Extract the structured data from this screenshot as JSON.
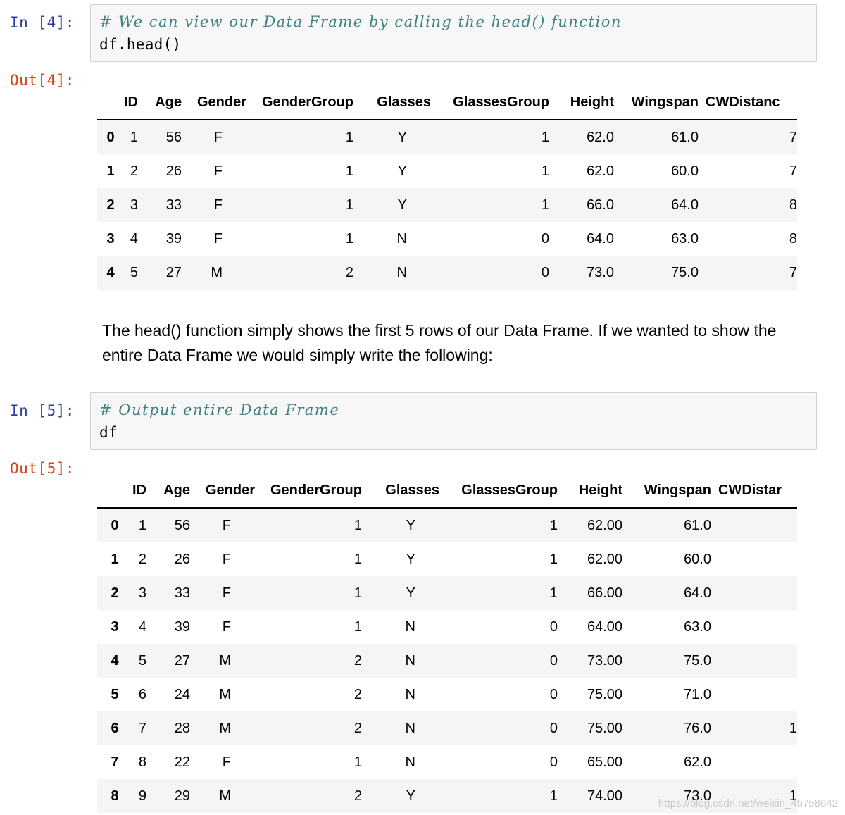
{
  "cells": [
    {
      "in_prompt": "In [4]:",
      "comment": "# We can view our Data Frame by calling the head() function",
      "code": "df.head()",
      "out_prompt": "Out[4]:",
      "columns": [
        "",
        "ID",
        "Age",
        "Gender",
        "GenderGroup",
        "Glasses",
        "GlassesGroup",
        "Height",
        "Wingspan",
        "CWDistanc"
      ],
      "rows": [
        [
          "0",
          "1",
          "56",
          "F",
          "1",
          "Y",
          "1",
          "62.0",
          "61.0",
          "7"
        ],
        [
          "1",
          "2",
          "26",
          "F",
          "1",
          "Y",
          "1",
          "62.0",
          "60.0",
          "7"
        ],
        [
          "2",
          "3",
          "33",
          "F",
          "1",
          "Y",
          "1",
          "66.0",
          "64.0",
          "8"
        ],
        [
          "3",
          "4",
          "39",
          "F",
          "1",
          "N",
          "0",
          "64.0",
          "63.0",
          "8"
        ],
        [
          "4",
          "5",
          "27",
          "M",
          "2",
          "N",
          "0",
          "73.0",
          "75.0",
          "7"
        ]
      ]
    },
    {
      "in_prompt": "In [5]:",
      "comment": "# Output entire Data Frame",
      "code": "df",
      "out_prompt": "Out[5]:",
      "columns": [
        "",
        "ID",
        "Age",
        "Gender",
        "GenderGroup",
        "Glasses",
        "GlassesGroup",
        "Height",
        "Wingspan",
        "CWDistar"
      ],
      "rows": [
        [
          "0",
          "1",
          "56",
          "F",
          "1",
          "Y",
          "1",
          "62.00",
          "61.0",
          ""
        ],
        [
          "1",
          "2",
          "26",
          "F",
          "1",
          "Y",
          "1",
          "62.00",
          "60.0",
          ""
        ],
        [
          "2",
          "3",
          "33",
          "F",
          "1",
          "Y",
          "1",
          "66.00",
          "64.0",
          ""
        ],
        [
          "3",
          "4",
          "39",
          "F",
          "1",
          "N",
          "0",
          "64.00",
          "63.0",
          ""
        ],
        [
          "4",
          "5",
          "27",
          "M",
          "2",
          "N",
          "0",
          "73.00",
          "75.0",
          ""
        ],
        [
          "5",
          "6",
          "24",
          "M",
          "2",
          "N",
          "0",
          "75.00",
          "71.0",
          ""
        ],
        [
          "6",
          "7",
          "28",
          "M",
          "2",
          "N",
          "0",
          "75.00",
          "76.0",
          "1"
        ],
        [
          "7",
          "8",
          "22",
          "F",
          "1",
          "N",
          "0",
          "65.00",
          "62.0",
          ""
        ],
        [
          "8",
          "9",
          "29",
          "M",
          "2",
          "Y",
          "1",
          "74.00",
          "73.0",
          "1"
        ]
      ]
    }
  ],
  "markdown": {
    "text": "The head() function simply shows the first 5 rows of our Data Frame. If we wanted to show the entire Data Frame we would simply write the following:"
  },
  "watermark": "https://blog.csdn.net/weixin_45758642"
}
